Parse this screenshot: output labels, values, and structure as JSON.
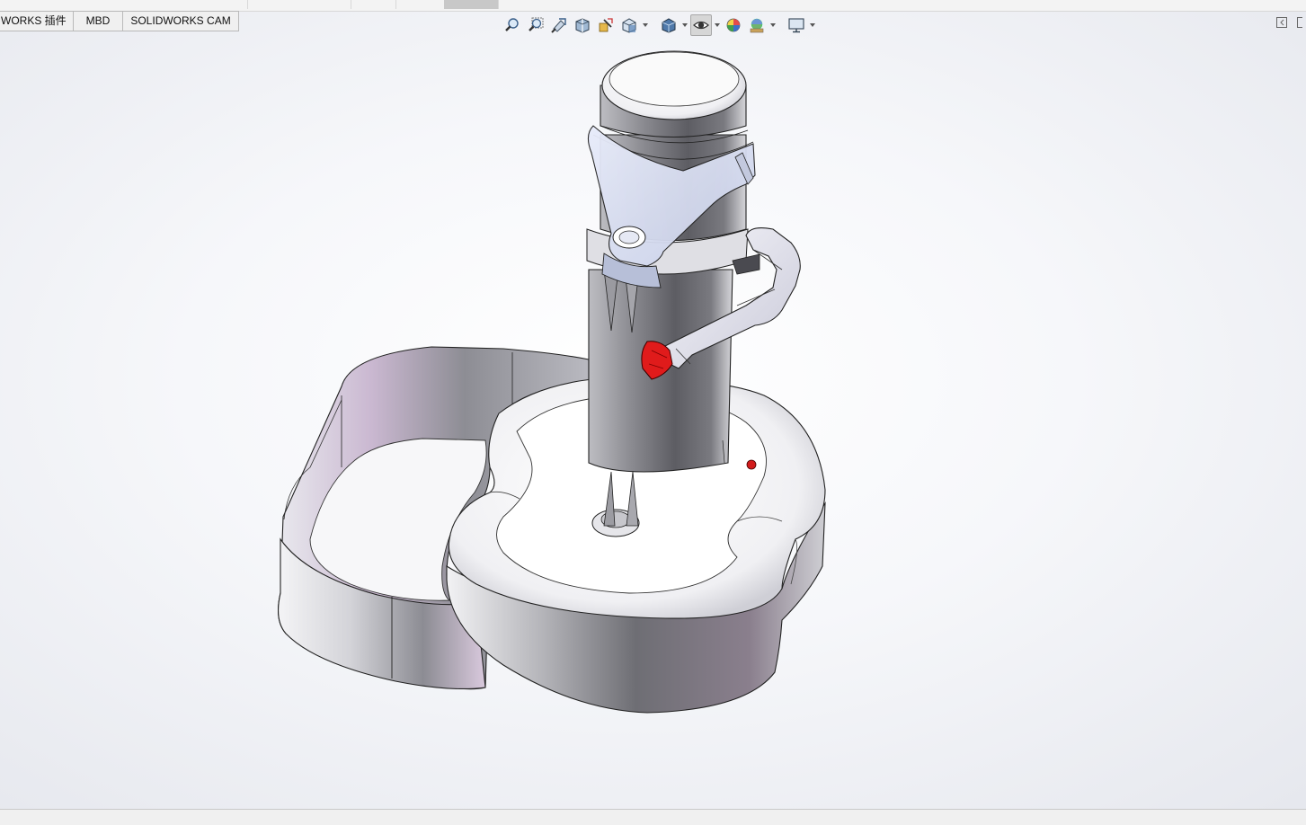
{
  "command_tabs": [
    {
      "label": "WORKS 插件"
    },
    {
      "label": "MBD"
    },
    {
      "label": "SOLIDWORKS CAM"
    }
  ],
  "heads_up_toolbar": [
    {
      "icon": "zoom-to-fit-icon"
    },
    {
      "icon": "zoom-to-area-icon"
    },
    {
      "icon": "previous-view-icon"
    },
    {
      "icon": "section-view-icon"
    },
    {
      "icon": "dynamic-annotation-views-icon"
    },
    {
      "icon": "view-orientation-icon"
    },
    {
      "icon": "display-style-icon"
    },
    {
      "icon": "hide-show-items-icon"
    },
    {
      "icon": "edit-appearance-icon"
    },
    {
      "icon": "apply-scene-icon"
    },
    {
      "icon": "view-settings-icon"
    }
  ],
  "colors": {
    "accent_part": "#e01b1b",
    "model_body": "#9a9aa0",
    "transparent_arm": "#dde3f5"
  }
}
